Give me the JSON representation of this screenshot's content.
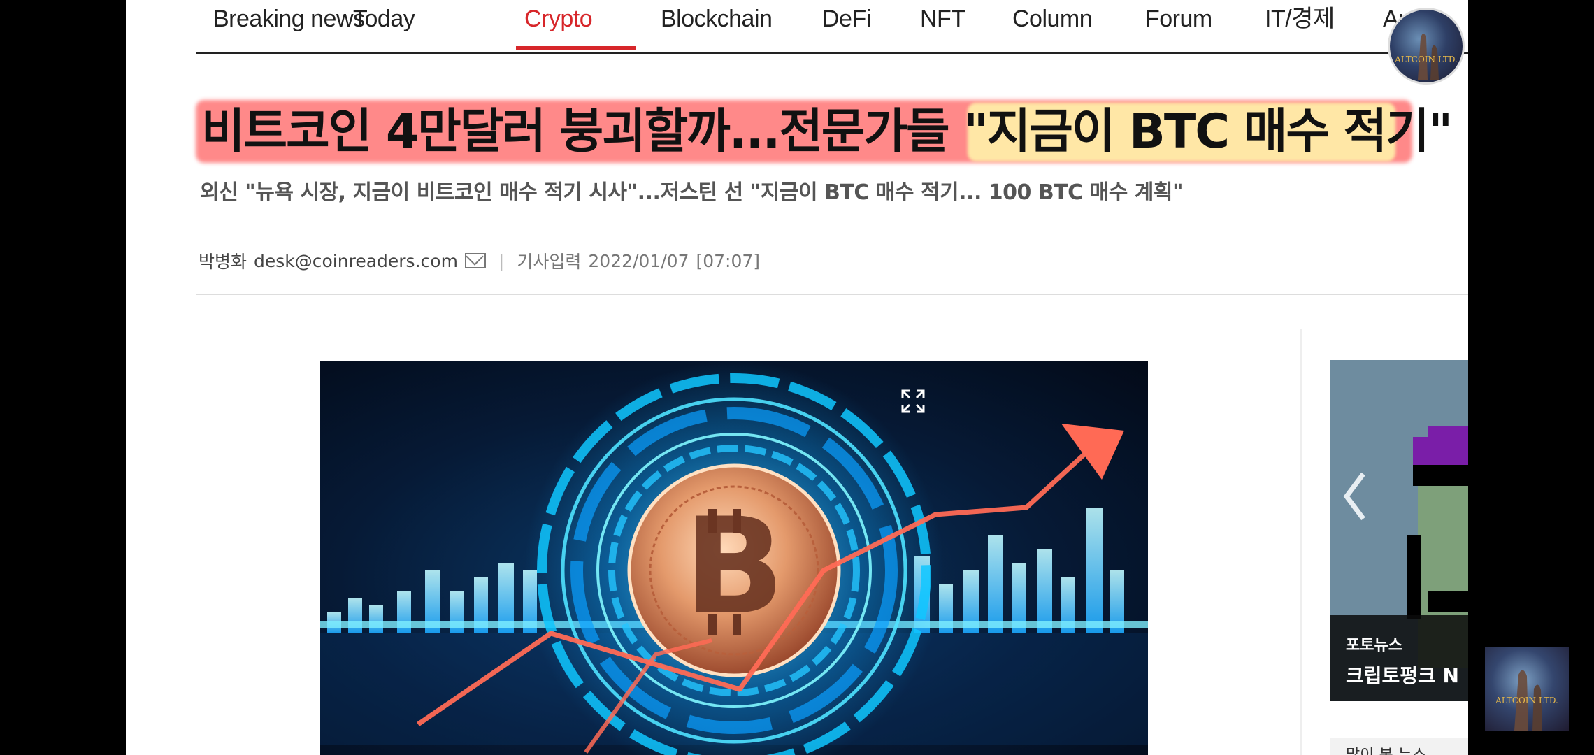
{
  "nav": {
    "items": [
      {
        "label": "Breaking news"
      },
      {
        "label": "Today"
      },
      {
        "label": "Crypto",
        "active": true
      },
      {
        "label": "Blockchain"
      },
      {
        "label": "DeFi"
      },
      {
        "label": "NFT"
      },
      {
        "label": "Column"
      },
      {
        "label": "Forum"
      },
      {
        "label": "IT/경제"
      },
      {
        "label": "Audio"
      }
    ],
    "active_color": "#d7262a"
  },
  "article": {
    "headline": "비트코인 4만달러 붕괴할까...전문가들 \"지금이 BTC 매수 적기\"",
    "subhead": "외신 \"뉴욕 시장, 지금이 비트코인 매수 적기 시사\"...저스틴 선 \"지금이 BTC 매수 적기... 100 BTC 매수 계획\"",
    "author": "박병화",
    "email": "desk@coinreaders.com",
    "published_label": "기사입력",
    "published_date": "2022/01/07",
    "published_time": "[07:07]"
  },
  "sidebar": {
    "tag": "포토뉴스",
    "title": "크립토펑크 N",
    "next_title": "많이 본 뉴스"
  },
  "watermark": {
    "text": "ALTCOIN LTD."
  },
  "icons": {
    "expand": "expand-icon",
    "mail": "mail-icon",
    "prev": "chevron-left-icon"
  }
}
